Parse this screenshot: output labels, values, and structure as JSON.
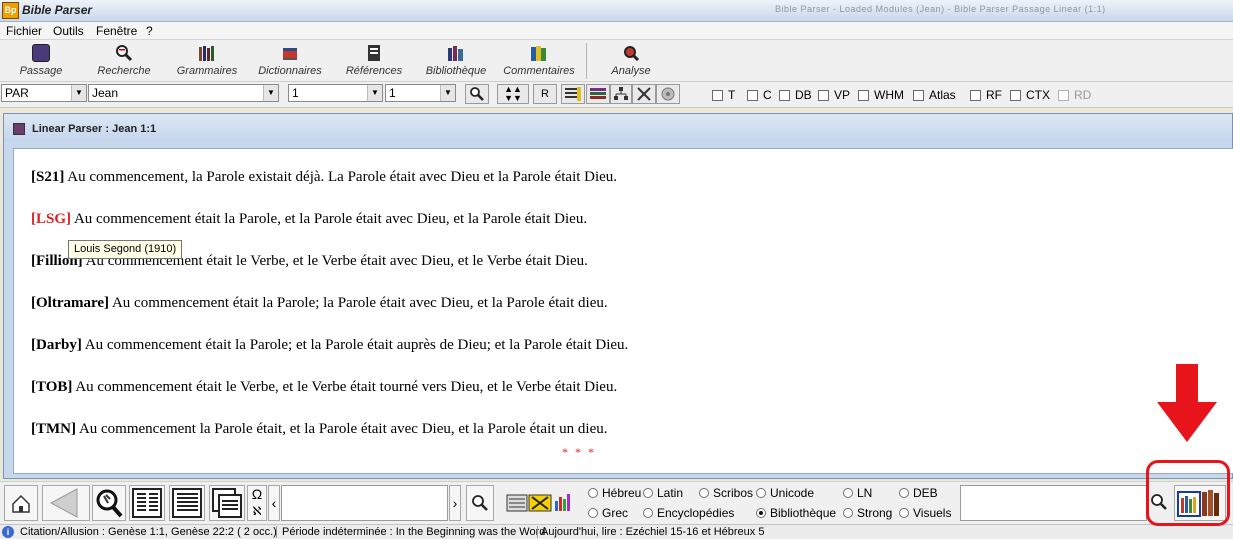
{
  "window": {
    "app_title": "Bible Parser",
    "app_icon": "bp-icon",
    "title_blur": "Bible Parser - Loaded Modules (Jean) - Bible Parser Passage Linear (1:1)"
  },
  "menu": [
    "Fichier",
    "Outils",
    "Fenêtre",
    "?"
  ],
  "toolbar": [
    {
      "label": "Passage",
      "icon": "book-icon"
    },
    {
      "label": "Recherche",
      "icon": "search-icon"
    },
    {
      "label": "Grammaires",
      "icon": "books-icon"
    },
    {
      "label": "Dictionnaires",
      "icon": "dictionary-icon"
    },
    {
      "label": "Références",
      "icon": "references-icon"
    },
    {
      "label": "Bibliothèque",
      "icon": "library-icon"
    },
    {
      "label": "Commentaires",
      "icon": "commentaries-icon"
    },
    {
      "label": "Analyse",
      "icon": "analysis-icon"
    }
  ],
  "selectors": {
    "version": "PAR",
    "book": "Jean",
    "chapter": "1",
    "verse": "1",
    "r_label": "R"
  },
  "checkboxes": [
    {
      "label": "T",
      "enabled": true
    },
    {
      "label": "C",
      "enabled": true
    },
    {
      "label": "DB",
      "enabled": true
    },
    {
      "label": "VP",
      "enabled": true
    },
    {
      "label": "WHM",
      "enabled": true
    },
    {
      "label": "Atlas",
      "enabled": true
    },
    {
      "label": "RF",
      "enabled": true
    },
    {
      "label": "CTX",
      "enabled": true
    },
    {
      "label": "RD",
      "enabled": false
    }
  ],
  "parser_window": {
    "title": "Linear Parser : Jean 1:1",
    "verses": [
      {
        "tag": "[S21]",
        "text": "Au commencement, la Parole existait déjà. La Parole était avec Dieu et la Parole était Dieu.",
        "highlight": false
      },
      {
        "tag": "[LSG]",
        "text": "Au commencement était la Parole, et la Parole était avec Dieu, et la Parole était Dieu.",
        "highlight": true
      },
      {
        "tag": "[Fillion]",
        "text": "Au commencement était le Verbe, et le Verbe était avec Dieu, et le Verbe était Dieu.",
        "highlight": false
      },
      {
        "tag": "[Oltramare]",
        "text": "Au commencement était la Parole; la Parole était avec Dieu, et la Parole était dieu.",
        "highlight": false
      },
      {
        "tag": "[Darby]",
        "text": "Au commencement était la Parole; et la Parole était auprès de Dieu; et la Parole était Dieu.",
        "highlight": false
      },
      {
        "tag": "[TOB]",
        "text": "Au commencement était le Verbe, et le Verbe était tourné vers Dieu, et le Verbe était Dieu.",
        "highlight": false
      },
      {
        "tag": "[TMN]",
        "text": "Au commencement la Parole était, et la Parole était avec Dieu, et la Parole était un dieu.",
        "highlight": false
      }
    ],
    "stars": "* * *",
    "tooltip": "Louis Segond (1910)"
  },
  "bottom": {
    "omega": "Ω",
    "aleph": "ℵ",
    "prev_arrow": "‹",
    "next_arrow": "›",
    "radios": [
      {
        "label": "Hébreu",
        "checked": false
      },
      {
        "label": "Latin",
        "checked": false
      },
      {
        "label": "Scribos",
        "checked": false
      },
      {
        "label": "Unicode",
        "checked": false
      },
      {
        "label": "LN",
        "checked": false
      },
      {
        "label": "DEB",
        "checked": false
      },
      {
        "label": "Grec",
        "checked": false
      },
      {
        "label": "Encyclopédies",
        "checked": false
      },
      {
        "label": "Bibliothèque",
        "checked": true
      },
      {
        "label": "Strong",
        "checked": false
      },
      {
        "label": "Visuels",
        "checked": false
      }
    ]
  },
  "status": {
    "info_icon": "i",
    "seg1": "Citation/Allusion : Genèse 1:1, Genèse 22:2 ( 2 occ.)",
    "seg2": "Période indéterminée : In the Beginning was the Word",
    "seg3": "Aujourd'hui, lire : Ezéchiel 15-16 et Hébreux 5"
  },
  "colors": {
    "accent_red": "#e8141c",
    "lsg_red": "#e02020"
  }
}
